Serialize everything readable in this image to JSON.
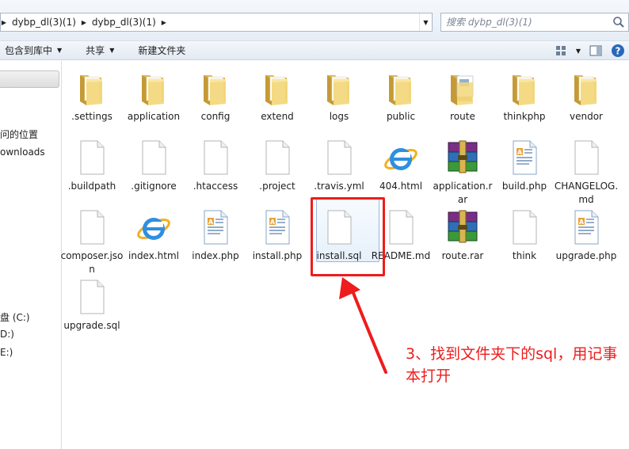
{
  "address": {
    "crumbs": [
      "dybp_dl(3)(1)",
      "dybp_dl(3)(1)"
    ]
  },
  "search": {
    "placeholder": "搜索 dybp_dl(3)(1)"
  },
  "toolbar": {
    "include_library": "包含到库中",
    "share": "共享",
    "new_folder": "新建文件夹"
  },
  "nav": {
    "recent_places": "问的位置",
    "downloads": "ownloads",
    "drive_c": "盘 (C:)",
    "drive_d": "D:)",
    "drive_e": "E:)"
  },
  "files": [
    {
      "name": ".settings",
      "type": "folder"
    },
    {
      "name": "application",
      "type": "folder"
    },
    {
      "name": "config",
      "type": "folder"
    },
    {
      "name": "extend",
      "type": "folder"
    },
    {
      "name": "logs",
      "type": "folder"
    },
    {
      "name": "public",
      "type": "folder"
    },
    {
      "name": "route",
      "type": "folder-doc"
    },
    {
      "name": "thinkphp",
      "type": "folder"
    },
    {
      "name": "vendor",
      "type": "folder"
    },
    {
      "name": ".buildpath",
      "type": "file"
    },
    {
      "name": ".gitignore",
      "type": "file"
    },
    {
      "name": ".htaccess",
      "type": "file"
    },
    {
      "name": ".project",
      "type": "file"
    },
    {
      "name": ".travis.yml",
      "type": "file"
    },
    {
      "name": "404.html",
      "type": "ie"
    },
    {
      "name": "application.rar",
      "type": "rar"
    },
    {
      "name": "build.php",
      "type": "php"
    },
    {
      "name": "CHANGELOG.md",
      "type": "file"
    },
    {
      "name": "composer.json",
      "type": "file"
    },
    {
      "name": "index.html",
      "type": "ie"
    },
    {
      "name": "index.php",
      "type": "php"
    },
    {
      "name": "install.php",
      "type": "php"
    },
    {
      "name": "install.sql",
      "type": "file"
    },
    {
      "name": "README.md",
      "type": "file"
    },
    {
      "name": "route.rar",
      "type": "rar"
    },
    {
      "name": "think",
      "type": "file"
    },
    {
      "name": "upgrade.php",
      "type": "php"
    },
    {
      "name": "upgrade.sql",
      "type": "file"
    }
  ],
  "annotation": {
    "text": "3、找到文件夹下的sql，用记事本打开",
    "color": "#ee1c1c"
  }
}
